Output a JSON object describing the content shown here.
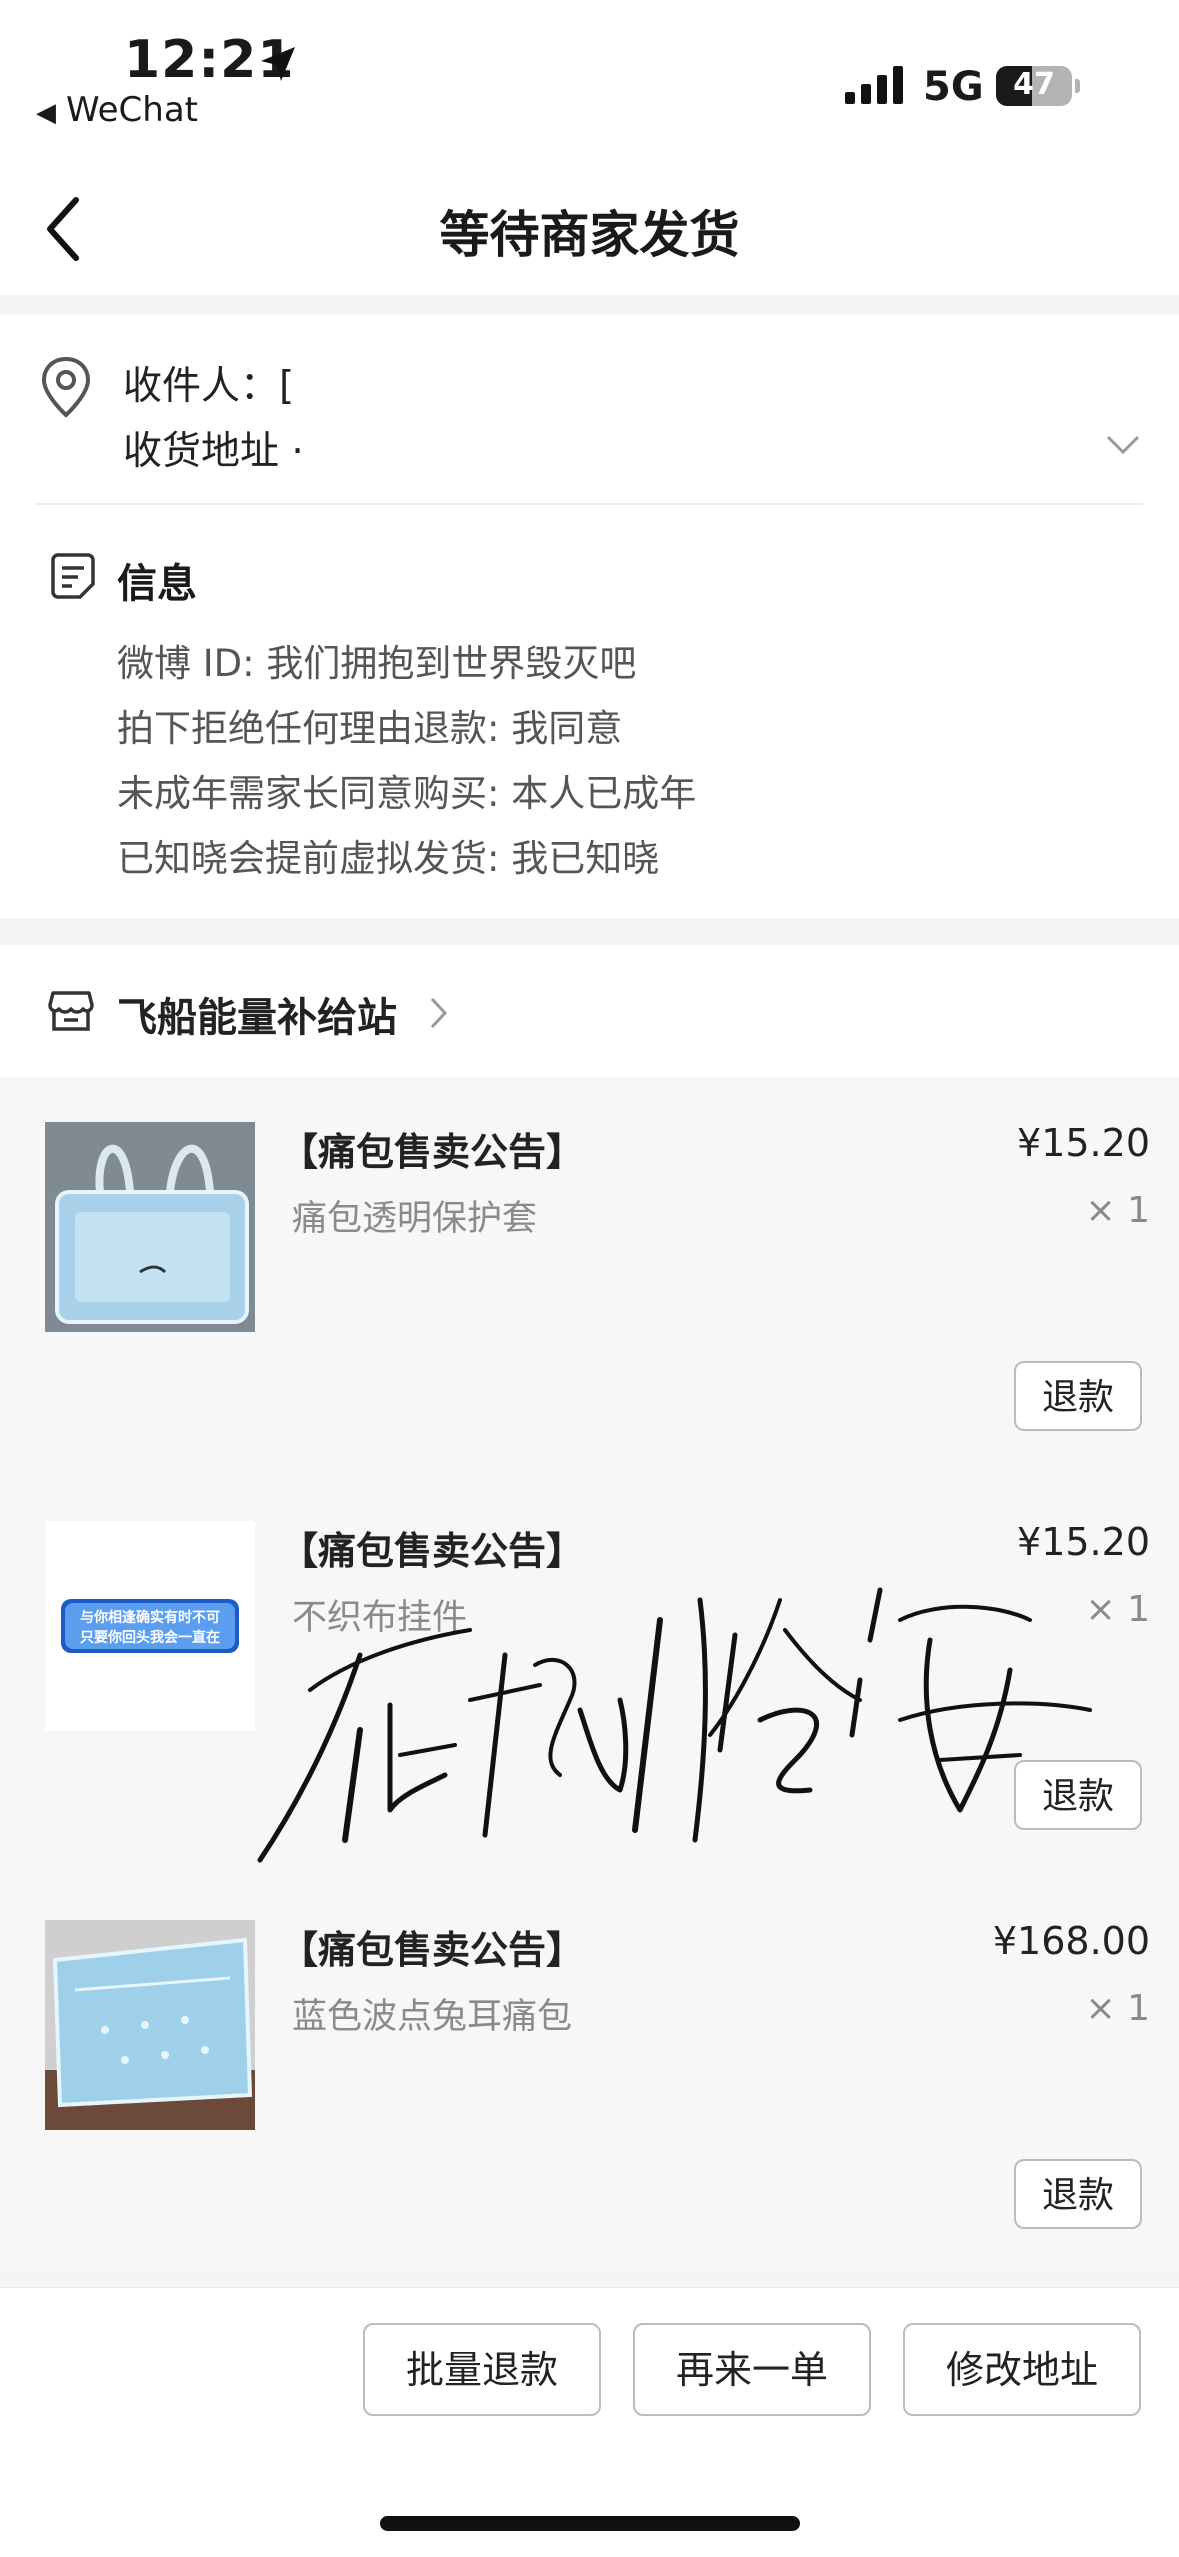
{
  "status_bar": {
    "time": "12:21",
    "back_app": "WeChat",
    "network": "5G",
    "battery": "47",
    "battery_level": 0.47
  },
  "nav": {
    "title": "等待商家发货"
  },
  "address": {
    "recipient": "收件人：[",
    "address": "收货地址 ·"
  },
  "info": {
    "title": "信息",
    "lines": [
      "微博 ID: 我们拥抱到世界毁灭吧",
      "拍下拒绝任何理由退款: 我同意",
      "未成年需家长同意购买: 本人已成年",
      "已知晓会提前虚拟发货: 我已知晓"
    ]
  },
  "store": {
    "name": "飞船能量补给站"
  },
  "items": [
    {
      "title": "【痛包售卖公告】",
      "subtitle": "痛包透明保护套",
      "price": "¥15.20",
      "qty": "× 1",
      "refund": "退款"
    },
    {
      "title": "【痛包售卖公告】",
      "subtitle": "不织布挂件",
      "price": "¥15.20",
      "qty": "× 1",
      "refund": "退款",
      "thumb_text": [
        "与你相逢确实有时不可",
        "只要你回头我会一直在"
      ]
    },
    {
      "title": "【痛包售卖公告】",
      "subtitle": "蓝色波点兔耳痛包",
      "price": "¥168.00",
      "qty": "× 1",
      "refund": "退款"
    }
  ],
  "watermark": {
    "text": "在杭州念海"
  },
  "actions": {
    "batch_refund": "批量退款",
    "reorder": "再来一单",
    "change_address": "修改地址"
  }
}
